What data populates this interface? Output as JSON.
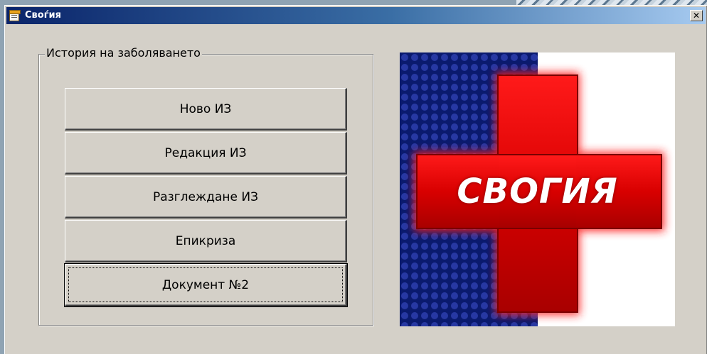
{
  "window": {
    "title": "Своѓия",
    "close_glyph": "✕",
    "icon": "notepad-icon"
  },
  "group": {
    "legend": "История на заболяването",
    "buttons": [
      {
        "label": "Ново ИЗ"
      },
      {
        "label": "Редакция ИЗ"
      },
      {
        "label": "Разглеждане ИЗ"
      },
      {
        "label": "Епикриза"
      },
      {
        "label": "Документ №2"
      }
    ]
  },
  "logo": {
    "text": "СВОГИЯ",
    "colors": {
      "cross": "#e00000",
      "blue": "#0a1a6e",
      "white": "#ffffff"
    }
  }
}
